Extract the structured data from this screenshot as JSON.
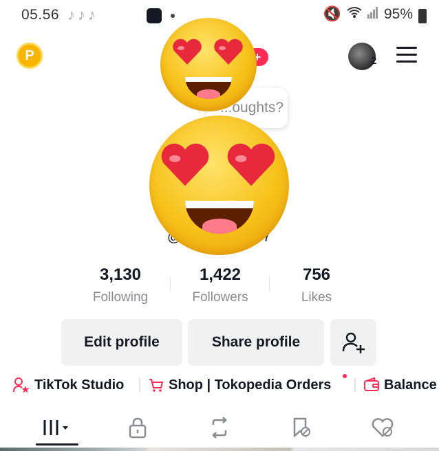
{
  "status_bar": {
    "time": "05.56",
    "battery": "95%"
  },
  "header": {
    "plus_label": "+",
    "notification_count": "2"
  },
  "thoughts_bubble": {
    "text": "...oughts?"
  },
  "profile": {
    "username_start": "@",
    "username_end": "7"
  },
  "stats": {
    "following_value": "3,130",
    "following_label": "Following",
    "followers_value": "1,422",
    "followers_label": "Followers",
    "likes_value": "756",
    "likes_label": "Likes"
  },
  "buttons": {
    "edit_profile": "Edit profile",
    "share_profile": "Share profile"
  },
  "quick_links": {
    "studio": "TikTok Studio",
    "shop": "Shop | Tokopedia Orders",
    "balance": "Balance"
  },
  "icons": {
    "points": "points-icon",
    "menu": "menu-icon",
    "add_friend": "add-friend-icon",
    "videos_tab": "grid-icon",
    "private_tab": "lock-icon",
    "reposts_tab": "repost-icon",
    "favorites_tab": "bookmark-icon",
    "liked_tab": "heart-icon"
  },
  "colors": {
    "accent": "#fe2c55",
    "points": "#f7b500",
    "text_primary": "#161823",
    "text_secondary": "#8a8b91",
    "button_bg": "#f1f1f2"
  }
}
